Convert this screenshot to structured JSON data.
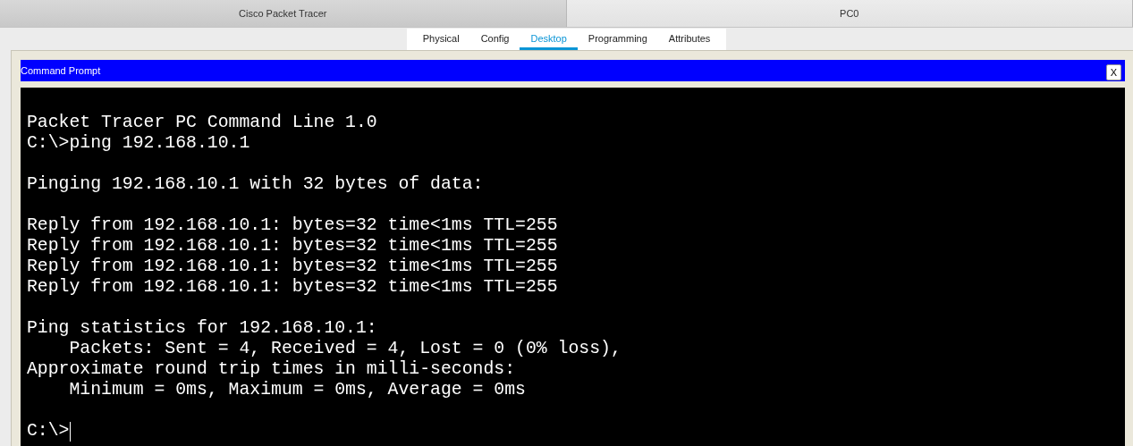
{
  "window_tabs": [
    {
      "label": "Cisco Packet Tracer",
      "selected": false
    },
    {
      "label": "PC0",
      "selected": true
    }
  ],
  "tabs": [
    {
      "label": "Physical",
      "selected": false
    },
    {
      "label": "Config",
      "selected": false
    },
    {
      "label": "Desktop",
      "selected": true
    },
    {
      "label": "Programming",
      "selected": false
    },
    {
      "label": "Attributes",
      "selected": false
    }
  ],
  "command_prompt": {
    "title": "Command Prompt",
    "close": "X",
    "blocks": [
      [
        "Packet Tracer PC Command Line 1.0",
        "C:\\>ping 192.168.10.1"
      ],
      [
        "Pinging 192.168.10.1 with 32 bytes of data:"
      ],
      [
        "Reply from 192.168.10.1: bytes=32 time<1ms TTL=255",
        "Reply from 192.168.10.1: bytes=32 time<1ms TTL=255",
        "Reply from 192.168.10.1: bytes=32 time<1ms TTL=255",
        "Reply from 192.168.10.1: bytes=32 time<1ms TTL=255"
      ],
      [
        "Ping statistics for 192.168.10.1:",
        "    Packets: Sent = 4, Received = 4, Lost = 0 (0% loss),",
        "Approximate round trip times in milli-seconds:",
        "    Minimum = 0ms, Maximum = 0ms, Average = 0ms"
      ]
    ],
    "prompt": "C:\\>",
    "cursor": true
  }
}
